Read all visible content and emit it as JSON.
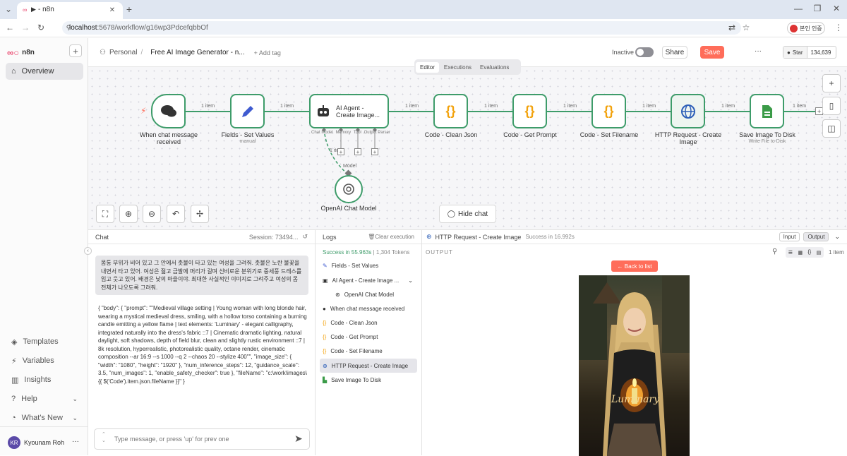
{
  "browser": {
    "tab_title": "n8n",
    "url_host": "localhost",
    "url_path": ":5678/workflow/g16wp3PdcefqbbOf",
    "profile_label": "본인 인증"
  },
  "sidebar": {
    "logo": "n8n",
    "items": [
      {
        "label": "Overview"
      },
      {
        "label": "Templates"
      },
      {
        "label": "Variables"
      },
      {
        "label": "Insights"
      },
      {
        "label": "Help"
      },
      {
        "label": "What's New"
      }
    ],
    "user_initials": "KR",
    "user_name": "Kyounam Roh",
    "user_menu": "···"
  },
  "header": {
    "project": "Personal",
    "separator": "/",
    "workflow_name": "Free AI Image Generator - n...",
    "add_tag": "+ Add tag",
    "status": "Inactive",
    "share": "Share",
    "save": "Save",
    "more": "···",
    "star": "Star",
    "star_count": "134,639"
  },
  "tabs": [
    {
      "label": "Editor"
    },
    {
      "label": "Executions"
    },
    {
      "label": "Evaluations"
    }
  ],
  "canvas": {
    "nodes": [
      {
        "label": "When chat message received",
        "sub": ""
      },
      {
        "label": "Fields - Set Values",
        "sub": "manual"
      },
      {
        "label": "AI Agent - Create Image...",
        "sub": ""
      },
      {
        "label": "Code - Clean Json",
        "sub": ""
      },
      {
        "label": "Code - Get Prompt",
        "sub": ""
      },
      {
        "label": "Code - Set Filename",
        "sub": ""
      },
      {
        "label": "HTTP Request - Create Image",
        "sub": ""
      },
      {
        "label": "Save Image To Disk",
        "sub": "Write File to Disk"
      }
    ],
    "edge_label": "1 item",
    "sub_ports": {
      "p1": "Chat Model",
      "p2": "Memory",
      "p3": "Tool",
      "p4": "Output Parser"
    },
    "model_label": "Model",
    "sub_node": {
      "label": "OpenAI Chat Model"
    },
    "hide_chat": "Hide chat"
  },
  "chat": {
    "title": "Chat",
    "session": "Session: 73494...",
    "user_message": "몸통 부위가 비어 있고 그 안에서 촛불이 타고 있는 여성을 그려줘. 촛불은 노란 불꽃을 내면서 타고 있어. 여성은 젊고 금발에 머리가 길며 신비로운 분위기로 중세풍 드레스를 입고 웃고 있어. 배경은 낮의 마을이야. 최대한 사실적인 이미지로 그려주고 여성의 몸 전체가 나오도록 그려줘.",
    "bot_message": "{ \"body\": { \"prompt\": \"\"Medieval village setting | Young woman with long blonde hair, wearing a mystical medieval dress, smiling, with a hollow torso containing a burning candle emitting a yellow flame | text elements: 'Luminary' - elegant calligraphy, integrated naturally into the dress's fabric ::7 | Cinematic dramatic lighting, natural daylight, soft shadows, depth of field blur, clean and slightly rustic environment ::7 | 8k resolution, hyperrealistic, photorealistic quality, octane render, cinematic composition --ar 16:9 --s 1000 --q 2 --chaos 20 --stylize 400\"\", \"image_size\": { \"width\": \"1080\", \"height\": \"1920\" }, \"num_inference_steps\": 12, \"guidance_scale\": 3.5, \"num_images\": 1, \"enable_safety_checker\": true }, \"fileName\": \"c:\\work\\images\\{{ $('Code').item.json.fileName }}\" }",
    "input_placeholder": "Type message, or press 'up' for prev one"
  },
  "logs": {
    "title": "Logs",
    "clear": "Clear execution",
    "summary_status": "Success in 55.963s",
    "summary_tokens": "1,304 Tokens",
    "items": [
      {
        "label": "Fields - Set Values",
        "icon": "pencil-icon"
      },
      {
        "label": "AI Agent - Create Image ...",
        "icon": "robot-icon"
      },
      {
        "label": "OpenAI Chat Model",
        "icon": "openai-icon"
      },
      {
        "label": "When chat message received",
        "icon": "chat-icon"
      },
      {
        "label": "Code - Clean Json",
        "icon": "code-icon"
      },
      {
        "label": "Code - Get Prompt",
        "icon": "code-icon"
      },
      {
        "label": "Code - Set Filename",
        "icon": "code-icon"
      },
      {
        "label": "HTTP Request - Create Image",
        "icon": "globe-icon"
      },
      {
        "label": "Save Image To Disk",
        "icon": "file-icon"
      }
    ]
  },
  "output": {
    "node_title": "HTTP Request - Create Image",
    "status": "Success in 16.992s",
    "input_tab": "Input",
    "output_tab": "Output",
    "section_label": "OUTPUT",
    "item_count": "1 item",
    "back_button": "← Back to list",
    "image_text": "Luminary"
  },
  "colors": {
    "accent": "#ff6d5a",
    "success": "#3e9c6a",
    "http_blue": "#2d5fb8",
    "code_orange": "#f2a20c",
    "pencil_blue": "#3f5bd0",
    "file_green": "#3b9b48"
  }
}
